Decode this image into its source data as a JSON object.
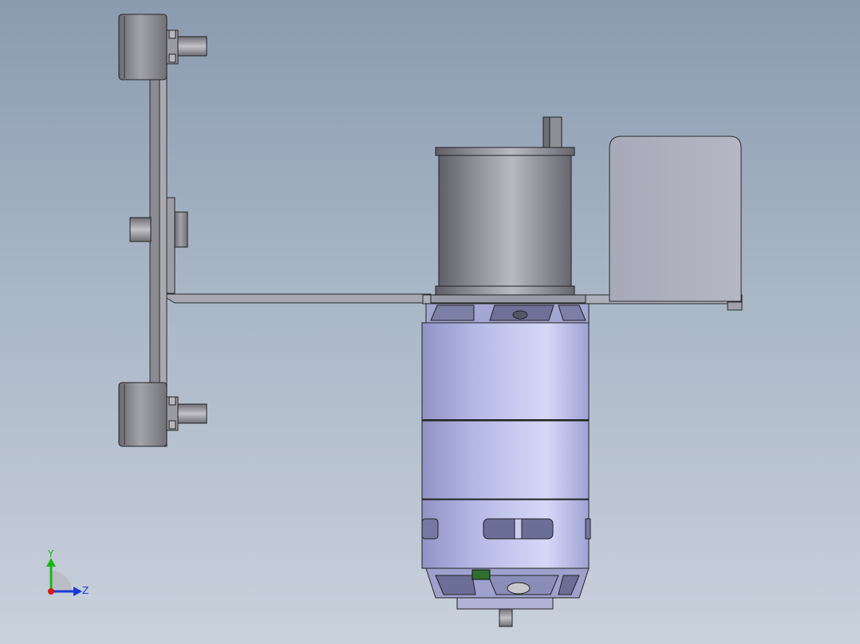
{
  "viewport": {
    "background_top": "#8a9bb0",
    "background_bottom": "#c9d1dc"
  },
  "model": {
    "parts": [
      "belt-tensioner-plate",
      "upper-pulley",
      "middle-pulley",
      "lower-pulley",
      "mounting-bracket",
      "gearbox",
      "output-shaft",
      "motor-body",
      "side-bracket"
    ]
  },
  "triad": {
    "y_label": "Y",
    "z_label": "Z",
    "y_color": "#18b818",
    "z_color": "#1a3ad8",
    "x_color": "#d81818"
  }
}
